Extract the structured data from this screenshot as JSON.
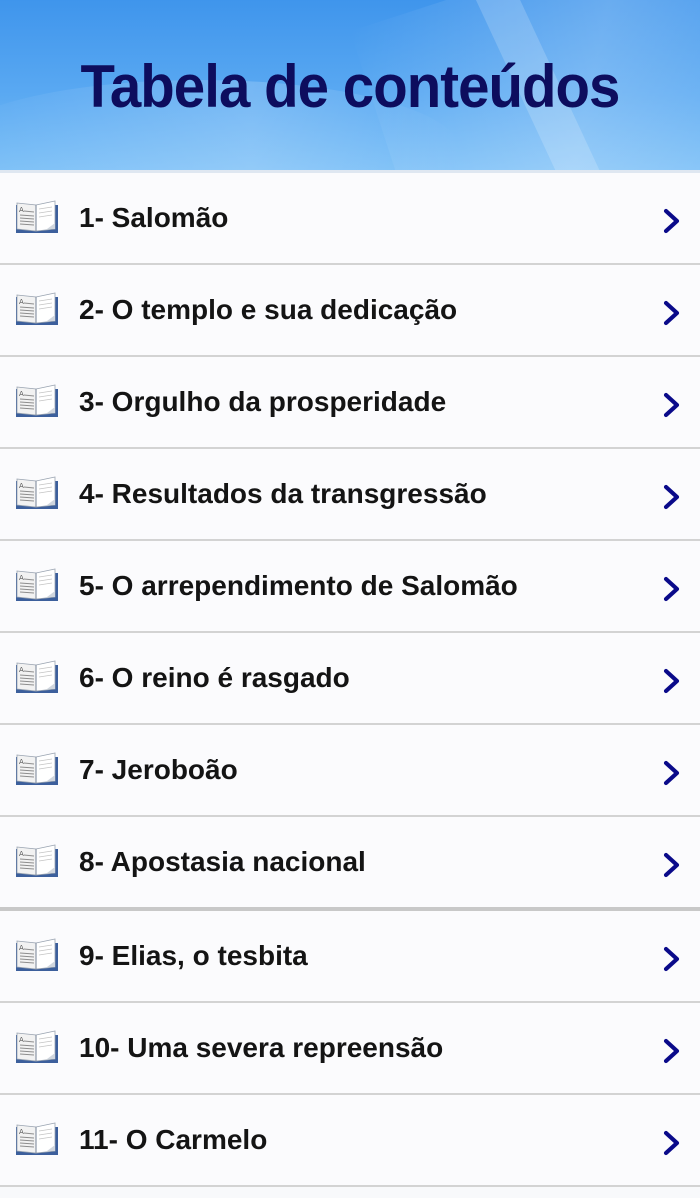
{
  "header": {
    "title": "Tabela de conteúdos"
  },
  "colors": {
    "title": "#0d0d5e",
    "chevron": "#0a0a8a",
    "header_blue": "#4a9ef0"
  },
  "items": [
    {
      "label": "1- Salomão",
      "icon": "book-icon"
    },
    {
      "label": "2- O templo e sua dedicação",
      "icon": "book-icon"
    },
    {
      "label": "3- Orgulho da prosperidade",
      "icon": "book-icon"
    },
    {
      "label": "4- Resultados da transgressão",
      "icon": "book-icon"
    },
    {
      "label": "5- O arrependimento de Salomão",
      "icon": "book-icon"
    },
    {
      "label": "6- O reino é rasgado",
      "icon": "book-icon"
    },
    {
      "label": "7- Jeroboão",
      "icon": "book-icon"
    },
    {
      "label": "8- Apostasia nacional",
      "icon": "book-icon"
    },
    {
      "label": "9- Elias, o tesbita",
      "icon": "book-icon"
    },
    {
      "label": "10- Uma severa repreensão",
      "icon": "book-icon"
    },
    {
      "label": "11- O Carmelo",
      "icon": "book-icon"
    }
  ]
}
